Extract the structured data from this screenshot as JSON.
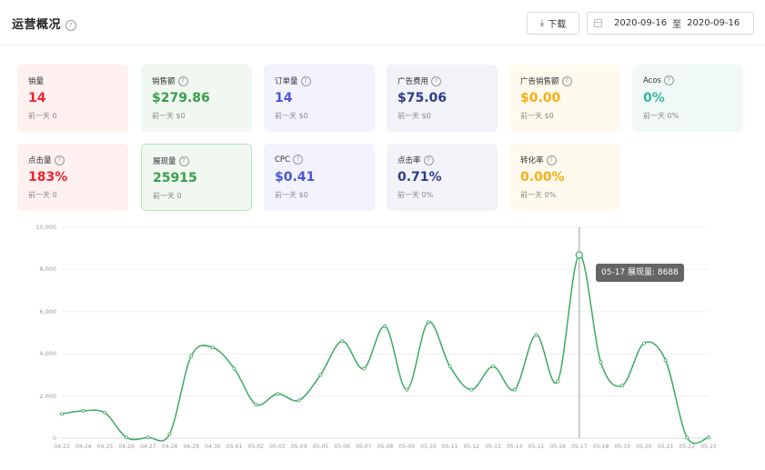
{
  "header": {
    "title": "运营概况",
    "download_label": "下载",
    "date_start": "2020-09-16",
    "date_sep": "至",
    "date_end": "2020-09-16"
  },
  "cards": [
    {
      "label": "销量",
      "help": false,
      "value": "14",
      "prev": "前一天 0",
      "color": "#f5222d",
      "bg": "#fff1f0",
      "border": "none"
    },
    {
      "label": "销售额",
      "help": true,
      "value": "$279.86",
      "prev": "前一天 $0",
      "color": "#389e4a",
      "bg": "#f0f8f1",
      "border": "none"
    },
    {
      "label": "订单量",
      "help": true,
      "value": "14",
      "prev": "前一天 $0",
      "color": "#4a55d6",
      "bg": "#f2f3ff",
      "border": "none"
    },
    {
      "label": "广告费用",
      "help": true,
      "value": "$75.06",
      "prev": "前一天 $0",
      "color": "#2e3a8c",
      "bg": "#f2f3f8",
      "border": "none"
    },
    {
      "label": "广告销售额",
      "help": true,
      "value": "$0.00",
      "prev": "前一天 $0",
      "color": "#faad14",
      "bg": "#fffaed",
      "border": "none"
    },
    {
      "label": "Acos",
      "help": true,
      "value": "0%",
      "prev": "前一天 0%",
      "color": "#36b5a0",
      "bg": "#f0f9f7",
      "border": "none"
    },
    {
      "label": "点击量",
      "help": true,
      "value": "183%",
      "prev": "前一天 0",
      "color": "#f5222d",
      "bg": "#fff1f0",
      "border": "none"
    },
    {
      "label": "展现量",
      "help": true,
      "value": "25915",
      "prev": "前一天 0",
      "color": "#389e4a",
      "bg": "#f0f8f1",
      "border": "#b7e3c0"
    },
    {
      "label": "CPC",
      "help": true,
      "value": "$0.41",
      "prev": "前一天 $0",
      "color": "#4a55d6",
      "bg": "#f2f3ff",
      "border": "none"
    },
    {
      "label": "点击率",
      "help": true,
      "value": "0.71%",
      "prev": "前一天 0%",
      "color": "#2e3a8c",
      "bg": "#f2f3f8",
      "border": "none"
    },
    {
      "label": "转化率",
      "help": true,
      "value": "0.00%",
      "prev": "前一天 0%",
      "color": "#faad14",
      "bg": "#fffaed",
      "border": "none"
    }
  ],
  "tooltip": {
    "text": "05-17 展现量: 8688"
  },
  "chart_data": {
    "type": "line",
    "series": [
      {
        "values": [
          1150,
          1300,
          1200,
          30,
          30,
          200,
          3900,
          4300,
          3300,
          1600,
          2100,
          1800,
          3000,
          4600,
          3300,
          5300,
          2300,
          5500,
          3400,
          2300,
          3400,
          2300,
          4900,
          2700,
          8688,
          3600,
          2500,
          4500,
          3700,
          30,
          30
        ]
      }
    ],
    "x": [
      "04-23",
      "04-24",
      "04-25",
      "04-26",
      "04-27",
      "04-28",
      "04-29",
      "04-30",
      "05-01",
      "05-02",
      "05-03",
      "05-04",
      "05-05",
      "05-06",
      "05-07",
      "05-08",
      "05-09",
      "05-10",
      "05-11",
      "05-12",
      "05-13",
      "05-14",
      "05-15",
      "05-16",
      "05-17",
      "05-18",
      "05-19",
      "05-20",
      "05-21",
      "05-22",
      "05-23"
    ],
    "yticks": [
      "0",
      "2,000",
      "4,000",
      "6,000",
      "8,000",
      "10,000"
    ],
    "ylim": [
      0,
      10000
    ],
    "highlight_index": 24,
    "line_color": "#3daa62",
    "grid": true
  }
}
